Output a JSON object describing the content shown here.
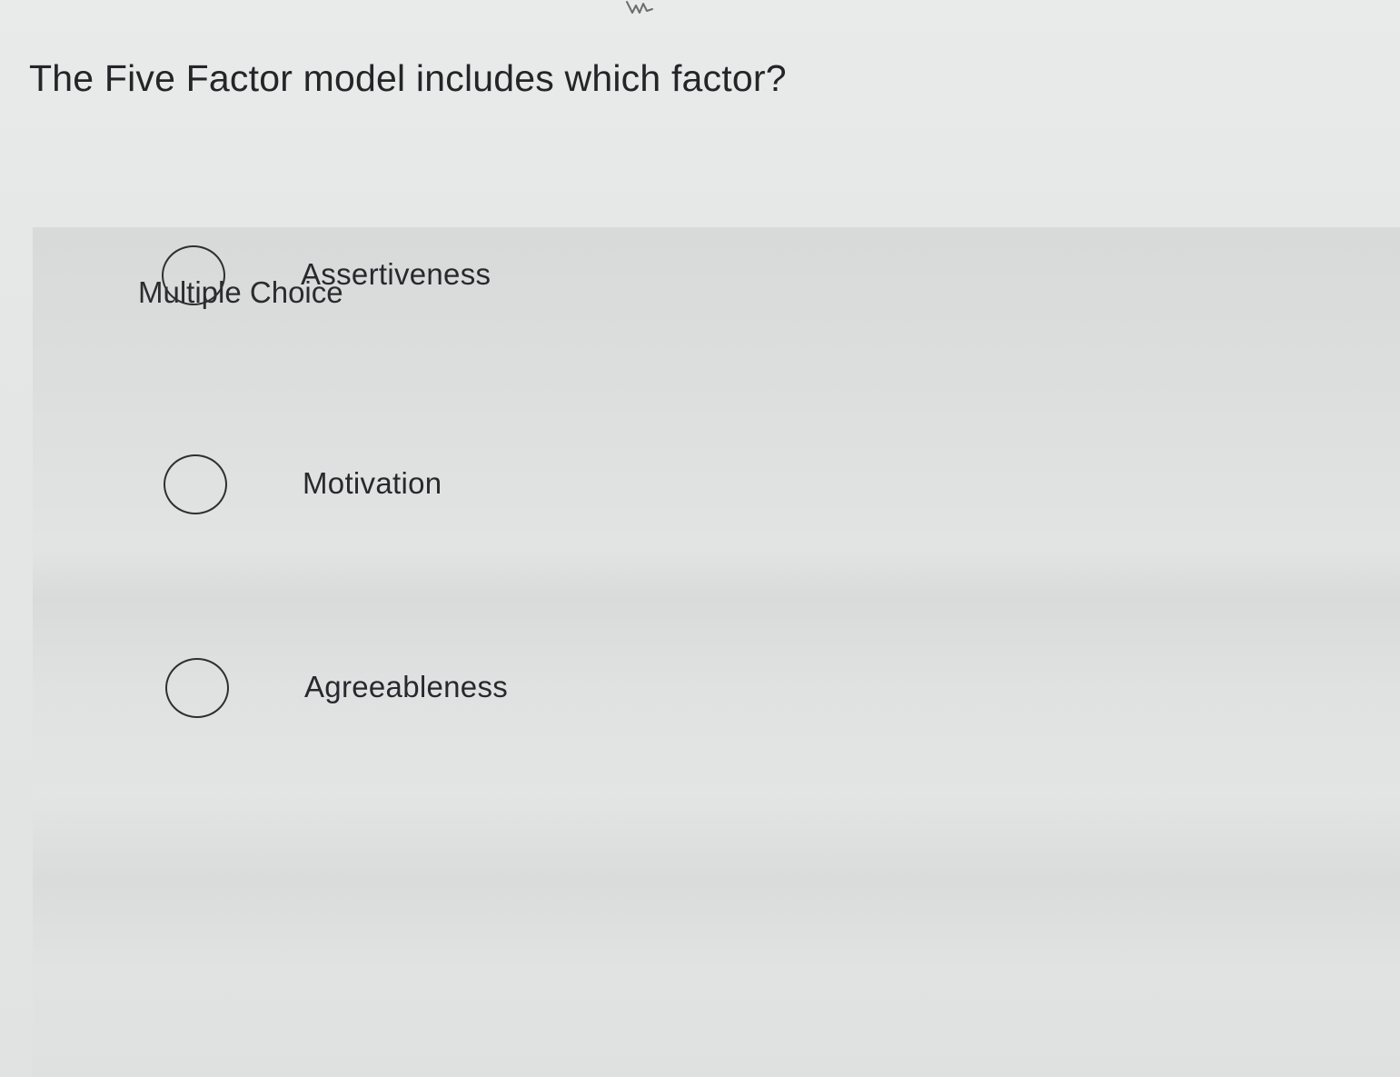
{
  "question": {
    "text": "The Five Factor model includes which factor?"
  },
  "section": {
    "label": "Multiple Choice"
  },
  "options": [
    {
      "label": "Assertiveness",
      "selected": false
    },
    {
      "label": "Motivation",
      "selected": false
    },
    {
      "label": "Agreeableness",
      "selected": false
    }
  ],
  "icons": {
    "cursor": "hand-pointer-icon",
    "radio": "radio-circle-icon"
  },
  "colors": {
    "background": "#e6e8e8",
    "card": "#dadcdc",
    "text": "#232527"
  }
}
